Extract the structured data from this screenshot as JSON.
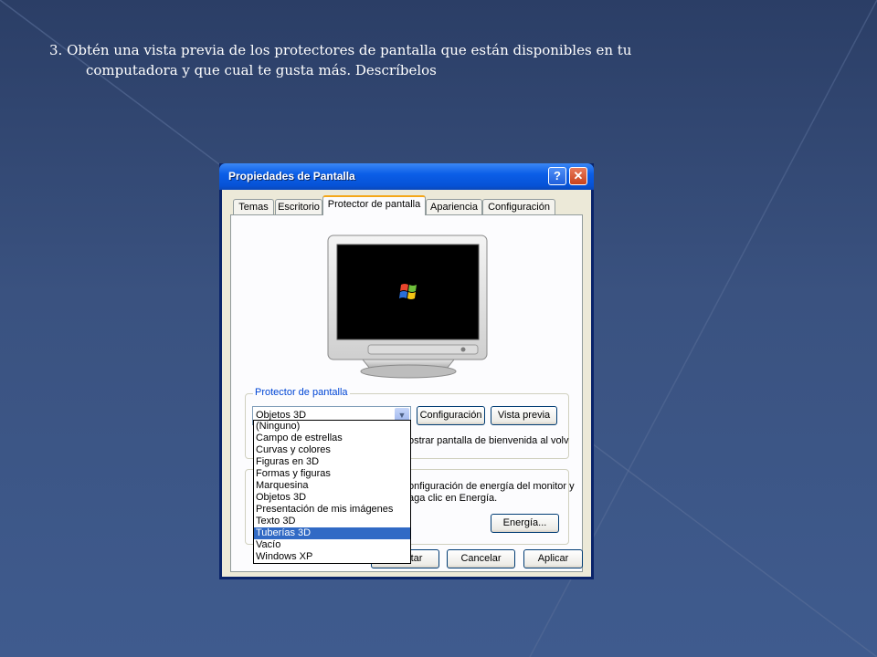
{
  "slide": {
    "line1": "3. Obtén una vista previa de los protectores de pantalla que están disponibles en tu",
    "line2": "computadora y que cual te gusta más. Descríbelos"
  },
  "window": {
    "title": "Propiedades de Pantalla",
    "help_glyph": "?",
    "close_glyph": "✕",
    "tabs": [
      "Temas",
      "Escritorio",
      "Protector de pantalla",
      "Apariencia",
      "Configuración"
    ],
    "active_tab": "Protector de pantalla"
  },
  "screensaver": {
    "group_label": "Protector de pantalla",
    "selected": "Objetos 3D",
    "settings_button": "Configuración",
    "preview_button": "Vista previa",
    "welcome_text": "ostrar pantalla de bienvenida al volv",
    "options": [
      "(Ninguno)",
      "Campo de estrellas",
      "Curvas y colores",
      "Figuras en 3D",
      "Formas y figuras",
      "Marquesina",
      "Objetos 3D",
      "Presentación de mis imágenes",
      "Texto 3D",
      "Tuberías 3D",
      "Vacío",
      "Windows XP"
    ],
    "highlighted_option": "Tuberías 3D"
  },
  "power": {
    "text_line1": "onfiguración de energía del monitor y",
    "text_line2": "aga clic en Energía.",
    "energy_button": "Energía..."
  },
  "footer": {
    "ok_button": "Aceptar",
    "cancel_button": "Cancelar",
    "apply_button": "Aplicar"
  },
  "icons": {
    "monitor": "crt-monitor-icon",
    "logo": "windows-logo-icon",
    "dropdown": "chevron-down-icon"
  }
}
